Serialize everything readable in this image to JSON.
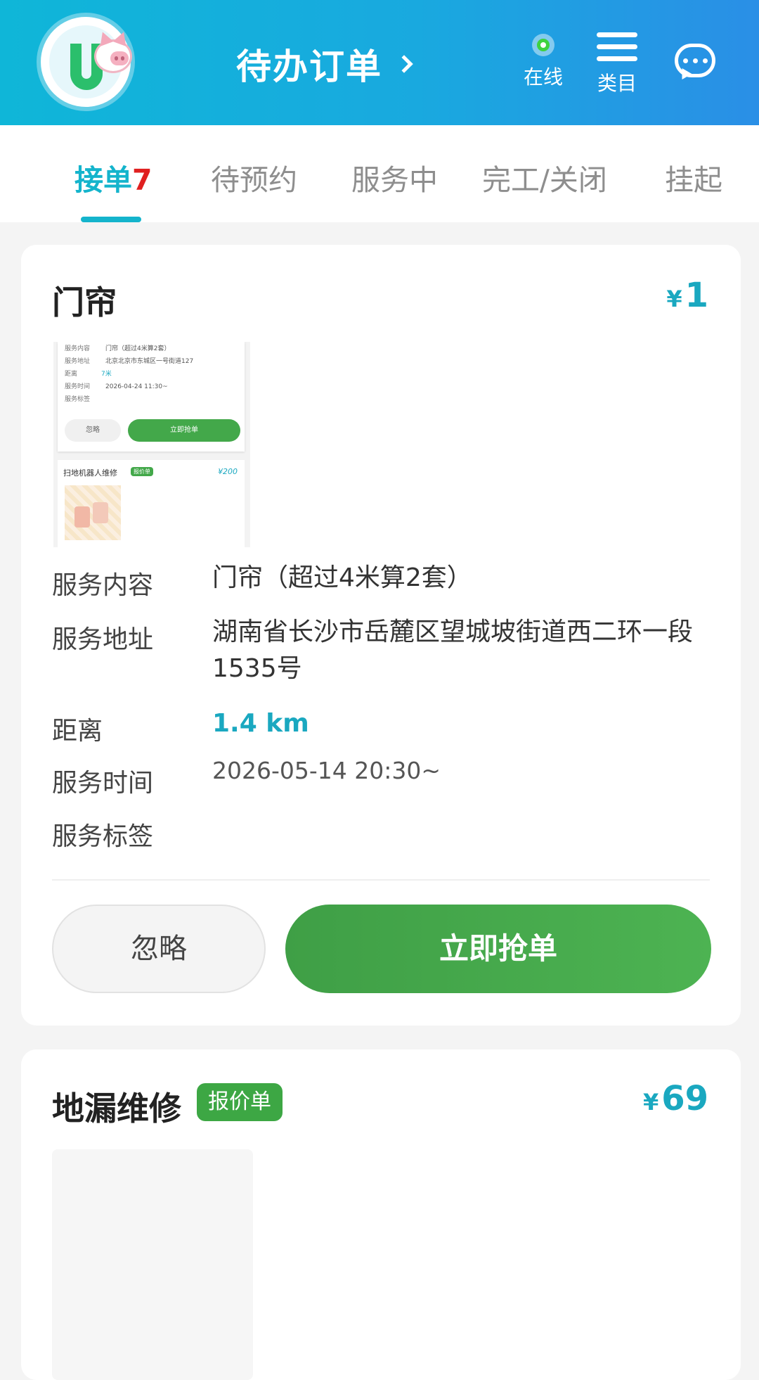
{
  "header": {
    "title": "待办订单",
    "status_label": "在线",
    "menu_label": "类目",
    "colors": {
      "start": "#0fb6d8",
      "end": "#2a8fe6",
      "online_dot": "#3fd23f"
    },
    "icons": [
      "pig-logo-icon",
      "chevron-right-icon",
      "online-dot-icon",
      "menu-icon",
      "chat-icon"
    ]
  },
  "tabs": [
    {
      "label": "接单",
      "count": "7",
      "active": true
    },
    {
      "label": "待预约"
    },
    {
      "label": "服务中"
    },
    {
      "label": "完工/关闭"
    },
    {
      "label": "挂起"
    }
  ],
  "orders": [
    {
      "title": "门帘",
      "currency": "¥",
      "price": "1",
      "thumbnail": {
        "rows": [
          {
            "label": "服务内容",
            "value": "门帘（超过4米算2套）"
          },
          {
            "label": "服务地址",
            "value": "北京北京市东城区一号街道127"
          },
          {
            "label": "距离",
            "value": "7米"
          },
          {
            "label": "服务时间",
            "value": "2026-04-24 11:30~"
          },
          {
            "label": "服务标签",
            "value": ""
          }
        ],
        "ignore": "忽略",
        "grab": "立即抢单",
        "next_title": "扫地机器人维修",
        "next_tag": "报价单",
        "next_price": "¥200"
      },
      "fields": [
        {
          "label": "服务内容",
          "value": "门帘（超过4米算2套）"
        },
        {
          "label": "服务地址",
          "value": "湖南省长沙市岳麓区望城坡街道西二环一段1535号"
        },
        {
          "label": "距离",
          "value": "1.4 km"
        },
        {
          "label": "服务时间",
          "value": "2026-05-14 20:30~"
        },
        {
          "label": "服务标签",
          "value": ""
        }
      ],
      "ignore_label": "忽略",
      "grab_label": "立即抢单"
    },
    {
      "title": "地漏维修",
      "tag": "报价单",
      "currency": "¥",
      "price": "69"
    }
  ],
  "colors": {
    "accent": "#14b4cc",
    "price": "#1aa8c0",
    "count": "#e02020",
    "grab_button": "#43a84a"
  }
}
